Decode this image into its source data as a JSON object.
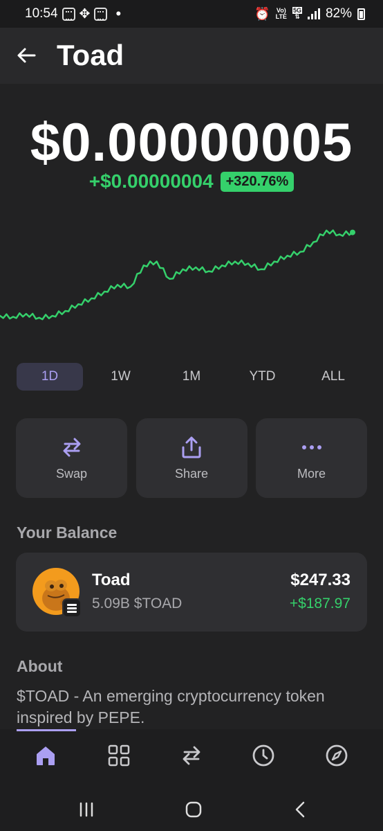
{
  "status_bar": {
    "time": "10:54",
    "network_small_top": "Vo)",
    "network_small_bottom": "LTE",
    "fiveg_top": "5G",
    "battery": "82%"
  },
  "header": {
    "title": "Toad"
  },
  "price": {
    "current": "$0.00000005",
    "change_abs": "+$0.00000004",
    "change_pct": "+320.76%",
    "accent_color": "#35d06b"
  },
  "chart_data": {
    "type": "line",
    "trend": "up",
    "color": "#35d06b",
    "grid": false,
    "y": [
      0.1,
      0.09,
      0.12,
      0.08,
      0.1,
      0.15,
      0.22,
      0.28,
      0.35,
      0.42,
      0.4,
      0.62,
      0.66,
      0.48,
      0.58,
      0.6,
      0.56,
      0.62,
      0.66,
      0.64,
      0.58,
      0.66,
      0.72,
      0.76,
      0.86,
      0.98,
      0.94,
      0.96
    ]
  },
  "time_ranges": [
    "1D",
    "1W",
    "1M",
    "YTD",
    "ALL"
  ],
  "active_range": "1D",
  "actions": {
    "swap": "Swap",
    "share": "Share",
    "more": "More"
  },
  "balance": {
    "section_title": "Your Balance",
    "token_name": "Toad",
    "token_amount": "5.09B $TOAD",
    "value": "$247.33",
    "change": "+$187.97"
  },
  "about": {
    "section_title": "About",
    "text": "$TOAD - An emerging cryptocurrency token inspired by PEPE."
  },
  "nav": {
    "active": "home",
    "accent_color": "#ab9ff2",
    "items": [
      "home-icon",
      "apps-grid-icon",
      "swap-icon",
      "history-clock-icon",
      "explore-compass-icon"
    ]
  }
}
